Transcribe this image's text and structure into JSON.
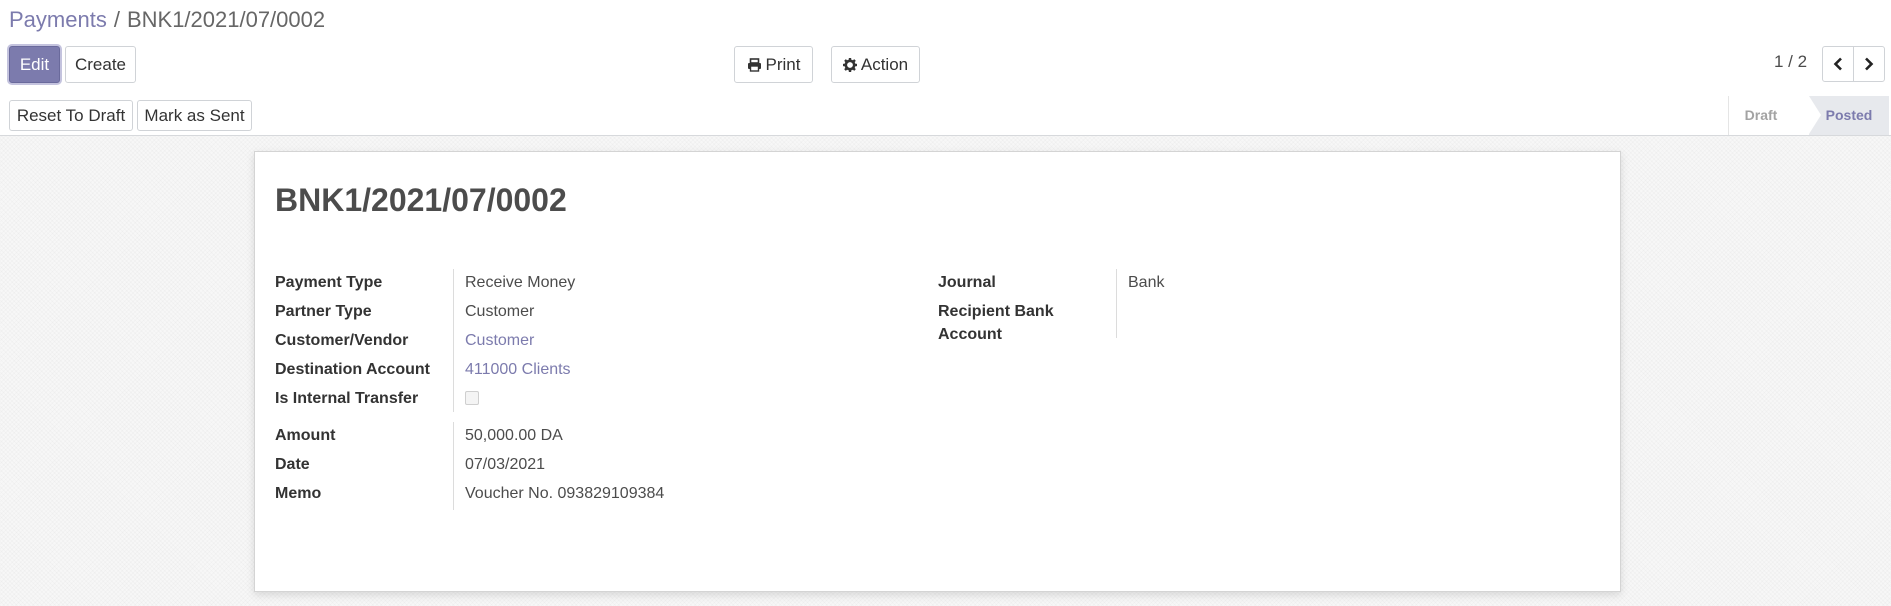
{
  "breadcrumb": {
    "parent": "Payments",
    "separator": "/",
    "current": "BNK1/2021/07/0002"
  },
  "toolbar": {
    "edit_label": "Edit",
    "create_label": "Create",
    "print_label": "Print",
    "action_label": "Action"
  },
  "pager": {
    "value": "1 / 2"
  },
  "statusbar": {
    "reset_label": "Reset To Draft",
    "mark_sent_label": "Mark as Sent",
    "steps": [
      {
        "label": "Draft",
        "active": false
      },
      {
        "label": "Posted",
        "active": true
      }
    ]
  },
  "form": {
    "title": "BNK1/2021/07/0002",
    "left_group": [
      {
        "label": "Payment Type",
        "value": "Receive Money"
      },
      {
        "label": "Partner Type",
        "value": "Customer"
      },
      {
        "label": "Customer/Vendor",
        "value": "Customer"
      },
      {
        "label": "Destination Account",
        "value": "411000 Clients"
      },
      {
        "label": "Is Internal Transfer",
        "value": ""
      }
    ],
    "is_internal_transfer": false,
    "right_group": [
      {
        "label": "Journal",
        "value": "Bank"
      },
      {
        "label": "Recipient Bank Account",
        "value": ""
      }
    ],
    "amount_group": [
      {
        "label": "Amount",
        "value": "50,000.00 DA"
      },
      {
        "label": "Date",
        "value": "07/03/2021"
      },
      {
        "label": "Memo",
        "value": "Voucher No. 093829109384"
      }
    ]
  },
  "colors": {
    "primary": "#7c7bad",
    "link": "#7c7bad",
    "text": "#4c4c4c",
    "background": "#f7f7f7"
  },
  "icons": {
    "print": "printer-icon",
    "action": "gear-icon",
    "prev": "chevron-left-icon",
    "next": "chevron-right-icon"
  }
}
